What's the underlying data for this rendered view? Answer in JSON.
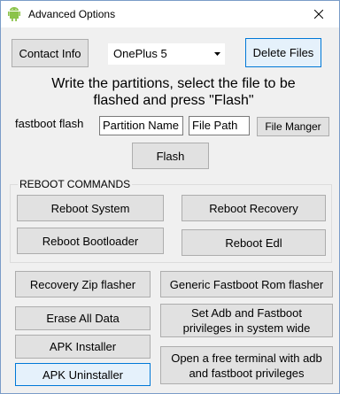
{
  "window": {
    "title": "Advanced Options",
    "app_icon": "android-icon",
    "close_icon": "close-icon"
  },
  "toolbar": {
    "contact_label": "Contact Info",
    "device_select": {
      "selected": "OnePlus 5"
    },
    "delete_label": "Delete Files"
  },
  "flash_section": {
    "instructions_line1": "Write the partitions, select the file to be",
    "instructions_line2": "flashed and press \"Flash\"",
    "command_label": "fastboot flash",
    "partition_value": "Partition Name",
    "file_path_value": "File Path",
    "file_manager_label": "File Manger",
    "flash_label": "Flash"
  },
  "reboot_group": {
    "title": "REBOOT COMMANDS",
    "system": "Reboot System",
    "recovery": "Reboot Recovery",
    "bootloader": "Reboot Bootloader",
    "edl": "Reboot Edl"
  },
  "tools": {
    "recovery_zip": "Recovery Zip flasher",
    "generic_rom": "Generic Fastboot Rom flasher",
    "erase_all": "Erase All Data",
    "set_adb_line1": "Set Adb and Fastboot",
    "set_adb_line2": "privileges in system wide",
    "apk_installer": "APK Installer",
    "apk_uninstaller": "APK Uninstaller",
    "terminal_line1": "Open a free terminal with adb",
    "terminal_line2": "and fastboot privileges"
  },
  "colors": {
    "window_bg": "#f0f0f0",
    "button_bg": "#e1e1e1",
    "focus_border": "#0078d7",
    "android_green": "#7cb342"
  }
}
